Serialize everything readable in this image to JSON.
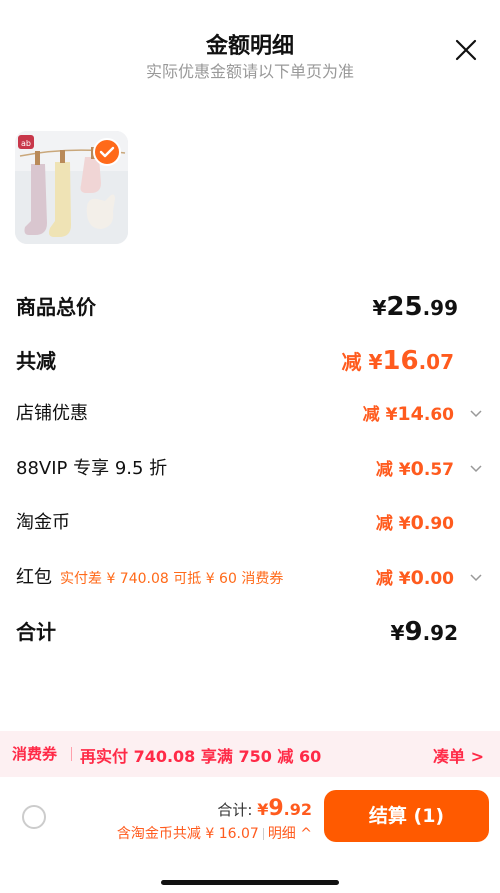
{
  "header": {
    "title": "金额明细",
    "subtitle": "实际优惠金额请以下单页为准"
  },
  "colors": {
    "accent": "#ff5a00",
    "discount_text": "#ff5b1e",
    "promo_text": "#ff2a47",
    "promo_bg": "#fdf0f2"
  },
  "items": {
    "total_price": {
      "label": "商品总价",
      "currency": "¥",
      "int": "25",
      "dec": ".99"
    },
    "total_discount": {
      "label": "共减",
      "prefix": "减 ¥",
      "int": "16",
      "dec": ".07"
    },
    "store_discount": {
      "label": "店铺优惠",
      "prefix": "减 ¥",
      "int": "14",
      "dec": ".60"
    },
    "vip_discount": {
      "label": "88VIP 专享 9.5 折",
      "prefix": "减 ¥",
      "int": "0",
      "dec": ".57"
    },
    "coins": {
      "label": "淘金币",
      "prefix": "减 ¥",
      "int": "0",
      "dec": ".90"
    },
    "red_packet": {
      "label": "红包",
      "note": "实付差 ¥ 740.08 可抵 ¥ 60 消费券",
      "prefix": "减 ¥",
      "int": "0",
      "dec": ".00"
    },
    "subtotal": {
      "label": "合计",
      "currency": "¥",
      "int": "9",
      "dec": ".92"
    }
  },
  "promo": {
    "tag": "消费券",
    "text": "再实付 740.08 享满 750 减 60",
    "link": "凑单 >"
  },
  "footer": {
    "total_label": "合计: ",
    "currency": "¥",
    "int": "9",
    "dec": ".92",
    "coin_note": "含淘金币共减 ¥ 16.07",
    "details": "明细 ^",
    "pay_button": "结算 (1)"
  },
  "product": {
    "brand_badge": "ab",
    "selected": true
  }
}
